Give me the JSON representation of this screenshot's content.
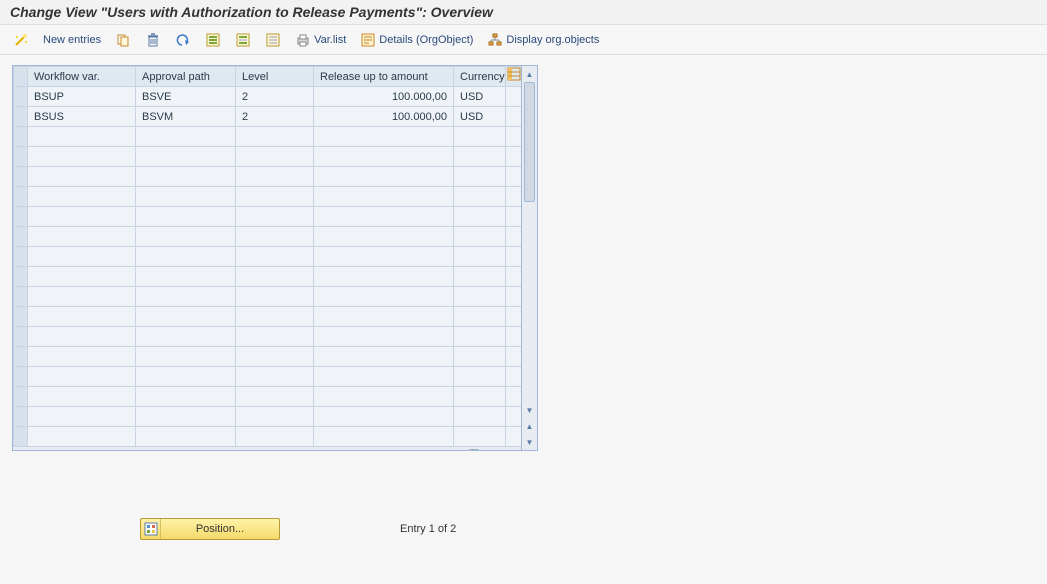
{
  "title": "Change View \"Users with Authorization to Release Payments\": Overview",
  "toolbar": {
    "new_entries": "New entries",
    "var_list": "Var.list",
    "details": "Details (OrgObject)",
    "display_org": "Display org.objects"
  },
  "table": {
    "columns": {
      "workflow_var": "Workflow var.",
      "approval_path": "Approval path",
      "level": "Level",
      "release_amount": "Release up to amount",
      "currency": "Currency"
    },
    "rows": [
      {
        "workflow_var": "BSUP",
        "approval_path": "BSVE",
        "level": "2",
        "release_amount": "100.000,00",
        "currency": "USD"
      },
      {
        "workflow_var": "BSUS",
        "approval_path": "BSVM",
        "level": "2",
        "release_amount": "100.000,00",
        "currency": "USD"
      }
    ],
    "empty_rows": 16
  },
  "footer": {
    "position_label": "Position...",
    "entry_text": "Entry 1 of 2"
  },
  "icons": {
    "wand": "wand-icon",
    "copy": "copy-icon",
    "delete": "delete-icon",
    "undo": "undo-icon",
    "select_all": "select-all-icon",
    "select_block": "select-block-icon",
    "deselect": "deselect-icon",
    "print": "print-icon",
    "detail": "detail-icon",
    "org": "org-icon",
    "config": "config-table-icon"
  }
}
